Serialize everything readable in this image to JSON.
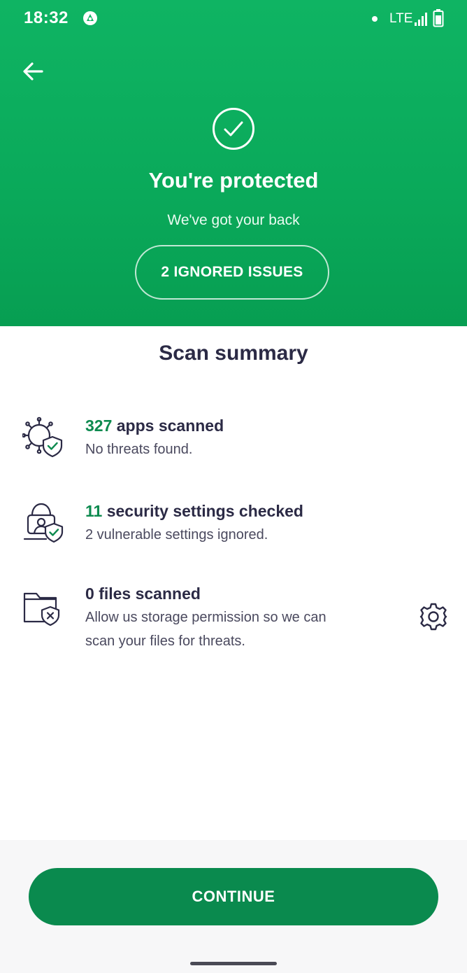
{
  "status_bar": {
    "time": "18:32",
    "network": "LTE"
  },
  "header": {
    "title": "You're protected",
    "subtitle": "We've got your back",
    "ignored_button": "2 IGNORED ISSUES"
  },
  "summary": {
    "title": "Scan summary",
    "items": [
      {
        "count": "327",
        "label": "apps scanned",
        "desc_lines": [
          "No threats found."
        ],
        "icon": "virus-shield-icon"
      },
      {
        "count": "11",
        "label": "security settings checked",
        "desc_lines": [
          "2 vulnerable settings ignored."
        ],
        "icon": "user-lock-shield-icon"
      },
      {
        "count": "0",
        "label": "files scanned",
        "desc_lines": [
          "Allow us storage permission so we can",
          "scan your files for threats."
        ],
        "icon": "folder-shield-icon",
        "action_icon": "gear-icon"
      }
    ]
  },
  "footer": {
    "continue_label": "CONTINUE"
  },
  "colors": {
    "brand_green": "#0fb463",
    "button_green": "#0a8a4e",
    "count_green": "#0d8a4f",
    "text_dark": "#2b2a45"
  }
}
